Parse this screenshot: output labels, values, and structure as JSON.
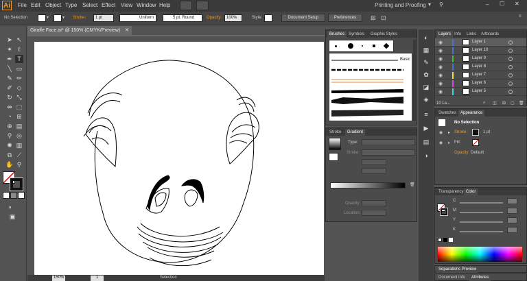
{
  "app": {
    "logo": "Ai",
    "workspace": "Printing and Proofing"
  },
  "menu": [
    "File",
    "Edit",
    "Object",
    "Type",
    "Select",
    "Effect",
    "View",
    "Window",
    "Help"
  ],
  "control_bar": {
    "selection": "No Selection",
    "stroke_label": "Stroke:",
    "stroke_value": "1 pt",
    "profile": "Uniform",
    "brush": "5 pt. Round",
    "opacity_label": "Opacity:",
    "opacity_value": "100%",
    "style_label": "Style:",
    "document_setup": "Document Setup",
    "preferences": "Preferences"
  },
  "document": {
    "tab_title": "Giraffe Face.ai* @ 150% (CMYK/Preview)"
  },
  "status": {
    "zoom": "150%",
    "artboard": "1",
    "tool": "Selection"
  },
  "brushes_panel": {
    "tabs": [
      "Brushes",
      "Symbols",
      "Graphic Styles"
    ],
    "basic_label": "Basic"
  },
  "gradient_panel": {
    "tabs": [
      "Stroke",
      "Gradient"
    ],
    "type_label": "Type:",
    "stroke_label": "Stroke:",
    "opacity_label": "Opacity:",
    "location_label": "Location:"
  },
  "layers_panel": {
    "tabs": [
      "Layers",
      "Info",
      "Links",
      "Artboards"
    ],
    "layers": [
      {
        "name": "Layer 1",
        "color": "#4a6fd6"
      },
      {
        "name": "Layer 10",
        "color": "#4a6fd6"
      },
      {
        "name": "Layer 9",
        "color": "#3cc03c"
      },
      {
        "name": "Layer 8",
        "color": "#4a6fd6"
      },
      {
        "name": "Layer 7",
        "color": "#e8e04a"
      },
      {
        "name": "Layer 6",
        "color": "#d84adf"
      },
      {
        "name": "Layer 5",
        "color": "#4ad0d8"
      }
    ],
    "footer_count": "10 La..."
  },
  "appearance_panel": {
    "tabs": [
      "Swatches",
      "Appearance"
    ],
    "title": "No Selection",
    "stroke_label": "Stroke:",
    "stroke_value": "1 pt",
    "fill_label": "Fill:",
    "opacity_label": "Opacity:",
    "opacity_value": "Default"
  },
  "color_panel": {
    "tabs": [
      "Transparency",
      "Color"
    ],
    "channels": [
      "C",
      "M",
      "Y",
      "K"
    ]
  },
  "bottom_panel": {
    "tabs": [
      "Separations Preview"
    ],
    "tabs2": [
      "Document Info",
      "Attributes"
    ]
  }
}
